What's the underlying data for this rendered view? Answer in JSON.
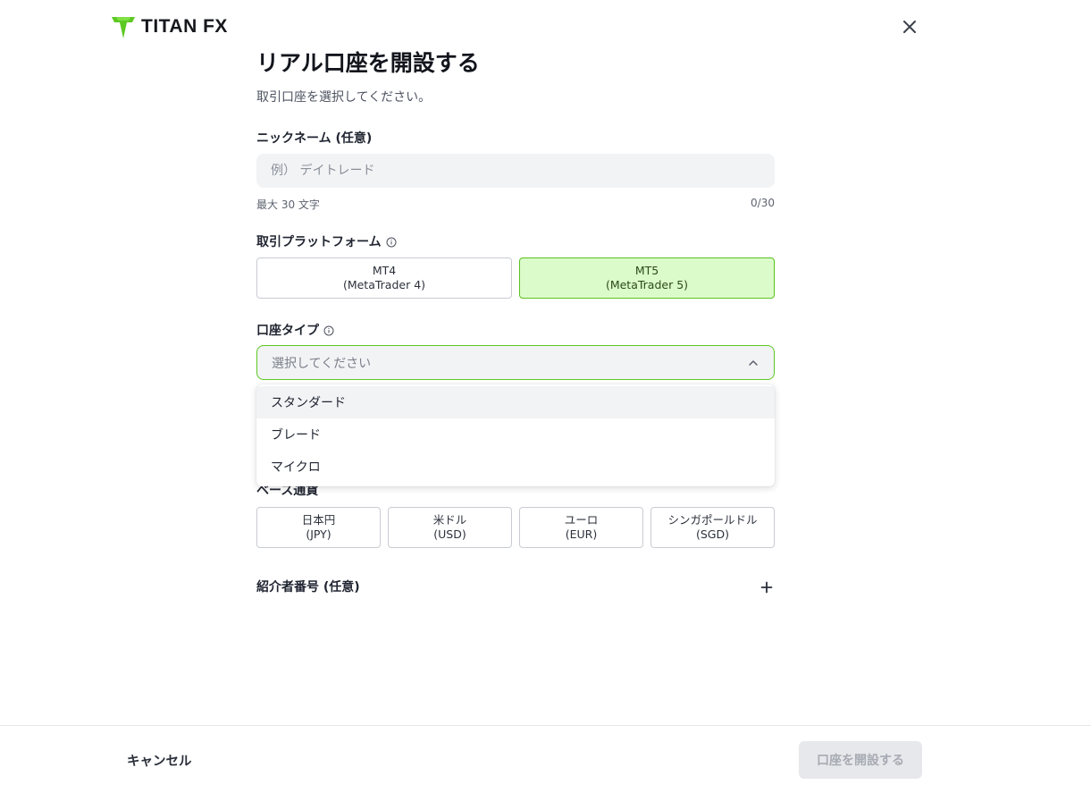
{
  "brand": {
    "name": "TITAN FX",
    "accent": "#59c21e"
  },
  "header": {
    "close_icon": "close-icon"
  },
  "form": {
    "title": "リアル口座を開設する",
    "subtitle": "取引口座を選択してください。",
    "nickname": {
      "label": "ニックネーム (任意)",
      "placeholder": "例） デイトレード",
      "value": "",
      "hint": "最大 30 文字",
      "counter": "0/30"
    },
    "platform": {
      "label": "取引プラットフォーム",
      "options": [
        {
          "line1": "MT4",
          "line2": "(MetaTrader 4)",
          "selected": false
        },
        {
          "line1": "MT5",
          "line2": "(MetaTrader 5)",
          "selected": true
        }
      ]
    },
    "account_type": {
      "label": "口座タイプ",
      "placeholder": "選択してください",
      "expanded": true,
      "options": [
        "スタンダード",
        "ブレード",
        "マイクロ"
      ]
    },
    "base_currency": {
      "label": "ベース通貨",
      "options": [
        {
          "line1": "日本円",
          "line2": "(JPY)"
        },
        {
          "line1": "米ドル",
          "line2": "(USD)"
        },
        {
          "line1": "ユーロ",
          "line2": "(EUR)"
        },
        {
          "line1": "シンガポールドル",
          "line2": "(SGD)"
        }
      ]
    },
    "referral": {
      "label": "紹介者番号 (任意)"
    }
  },
  "footer": {
    "cancel_label": "キャンセル",
    "submit_label": "口座を開設する"
  }
}
